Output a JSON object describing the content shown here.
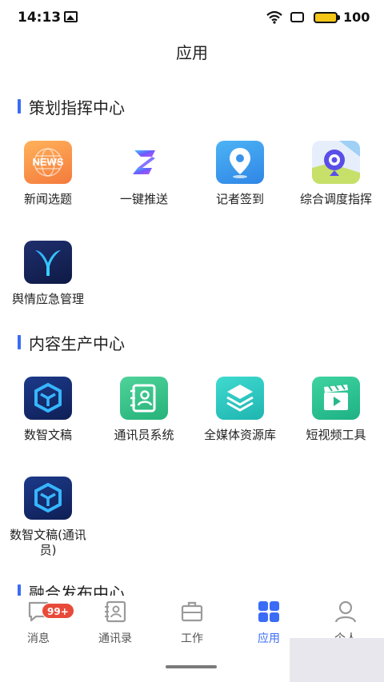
{
  "status_bar": {
    "time": "14:13",
    "battery": "100"
  },
  "header": {
    "title": "应用"
  },
  "sections": [
    {
      "title": "策划指挥中心",
      "apps": [
        {
          "label": "新闻选题",
          "icon": "news-icon"
        },
        {
          "label": "一键推送",
          "icon": "push-icon"
        },
        {
          "label": "记者签到",
          "icon": "location-checkin-icon"
        },
        {
          "label": "综合调度指挥",
          "icon": "dispatch-map-icon"
        },
        {
          "label": "舆情应急管理",
          "icon": "opinion-y-icon"
        }
      ]
    },
    {
      "title": "内容生产中心",
      "apps": [
        {
          "label": "数智文稿",
          "icon": "cube-icon"
        },
        {
          "label": "通讯员系统",
          "icon": "contact-card-icon"
        },
        {
          "label": "全媒体资源库",
          "icon": "layers-icon"
        },
        {
          "label": "短视频工具",
          "icon": "clapperboard-icon"
        },
        {
          "label": "数智文稿(通讯员)",
          "icon": "cube-icon"
        }
      ]
    },
    {
      "title": "融合发布中心",
      "apps": []
    }
  ],
  "tab_bar": {
    "items": [
      {
        "label": "消息",
        "icon": "message-icon",
        "badge": "99+"
      },
      {
        "label": "通讯录",
        "icon": "contacts-icon"
      },
      {
        "label": "工作",
        "icon": "briefcase-icon"
      },
      {
        "label": "应用",
        "icon": "apps-grid-icon"
      },
      {
        "label": "个人",
        "icon": "person-icon"
      }
    ],
    "active_index": 3
  },
  "colors": {
    "accent": "#3b6cf6",
    "badge": "#e84a3a"
  }
}
